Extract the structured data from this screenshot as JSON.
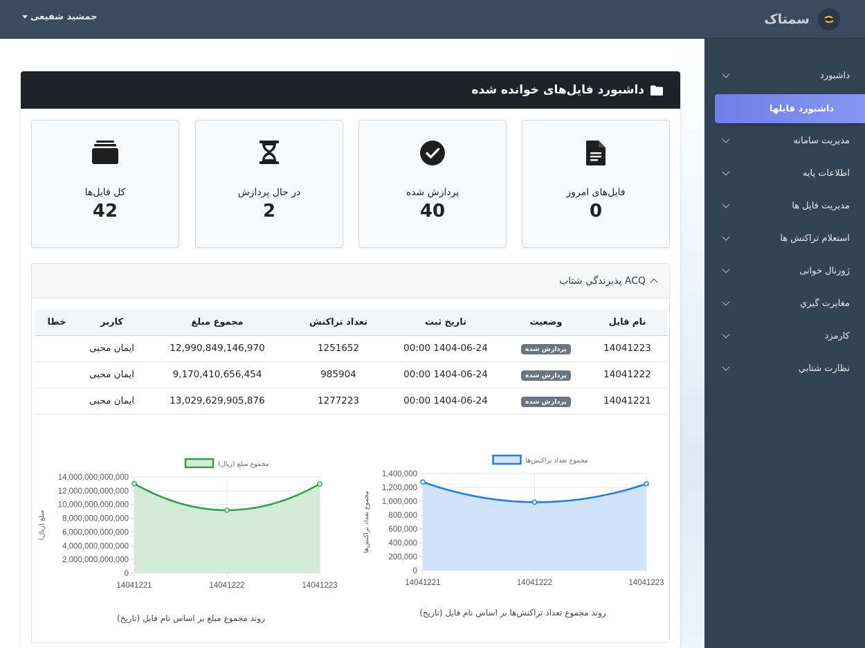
{
  "app": {
    "brand": "سمتاک",
    "user": "جمشید شفیعی"
  },
  "sidebar": {
    "items": [
      {
        "label": "داشبورد",
        "name": "dashboard"
      },
      {
        "label": "داشبورد فایلها",
        "name": "files-dashboard",
        "active": true
      },
      {
        "label": "مديريت سامانه",
        "name": "system-management"
      },
      {
        "label": "اطلاعات پايه",
        "name": "base-info"
      },
      {
        "label": "مدیریت فایل ها",
        "name": "file-management"
      },
      {
        "label": "استعلام تراکنش ها",
        "name": "transaction-inquiry"
      },
      {
        "label": "ژورنال خوانی",
        "name": "journal-reading"
      },
      {
        "label": "مغايرت گيري",
        "name": "reconciliation"
      },
      {
        "label": "کارمزد",
        "name": "commission"
      },
      {
        "label": "نظارت شتابي",
        "name": "shetab-monitoring"
      }
    ]
  },
  "page": {
    "title": "داشبورد فایل‌های خوانده شده"
  },
  "stats": [
    {
      "label": "فایل‌های امروز",
      "value": "0",
      "icon": "file-icon"
    },
    {
      "label": "پردازش شده",
      "value": "40",
      "icon": "check-circle-icon"
    },
    {
      "label": "در حال پردازش",
      "value": "2",
      "icon": "hourglass-icon"
    },
    {
      "label": "کل فایل‌ها",
      "value": "42",
      "icon": "layers-icon"
    }
  ],
  "acq": {
    "title": "پذيرندگي شتاب ACQ",
    "columns": [
      "نام فایل",
      "وضعیت",
      "تاریخ ثبت",
      "تعداد تراکنش",
      "مجموع مبلغ",
      "کاربر",
      "خطا"
    ],
    "rows": [
      {
        "file": "14041223",
        "status": "پردازش شده",
        "date": "1404-06-24 00:00",
        "count": "1251652",
        "amount": "12,990,849,146,970",
        "user": "ایمان محبی",
        "error": ""
      },
      {
        "file": "14041222",
        "status": "پردازش شده",
        "date": "1404-06-24 00:00",
        "count": "985904",
        "amount": "9,170,410,656,454",
        "user": "ایمان محبی",
        "error": ""
      },
      {
        "file": "14041221",
        "status": "پردازش شده",
        "date": "1404-06-24 00:00",
        "count": "1277223",
        "amount": "13,029,629,905,876",
        "user": "ایمان محبی",
        "error": ""
      }
    ]
  },
  "colors": {
    "green": "#2ea24a",
    "blue": "#1f7fe0",
    "header": "#1e2226",
    "sidebar": "#344256",
    "topbar": "#3b4a5e"
  },
  "chart_data": [
    {
      "type": "area",
      "title": "روند مجموع مبلغ بر اساس نام فایل (تاریخ)",
      "xlabel": "نام فایل (تاریخ)",
      "ylabel": "مبلغ (ریال)",
      "categories": [
        "14041221",
        "14041222",
        "14041223"
      ],
      "series": [
        {
          "name": "مجموع مبلغ (ریال)",
          "values": [
            13029629905876,
            9170410656454,
            12990849146970
          ]
        }
      ],
      "ylim": [
        0,
        14000000000000
      ],
      "yticks": [
        "0",
        "2,000,000,000,000",
        "4,000,000,000,000",
        "6,000,000,000,000",
        "8,000,000,000,000",
        "10,000,000,000,000",
        "12,000,000,000,000",
        "14,000,000,000,000"
      ],
      "color": "#2ea24a",
      "fill": "#d4ebd7",
      "legend": "top"
    },
    {
      "type": "area",
      "title": "روند مجموع تعداد تراکنش‌ها بر اساس نام فایل (تاریخ)",
      "xlabel": "نام فایل (تاریخ)",
      "ylabel": "مجموع تعداد تراکنش‌ها",
      "categories": [
        "14041221",
        "14041222",
        "14041223"
      ],
      "series": [
        {
          "name": "مجموع تعداد تراکنش‌ها",
          "values": [
            1277223,
            985904,
            1251652
          ]
        }
      ],
      "ylim": [
        0,
        1400000
      ],
      "yticks": [
        "0",
        "200,000",
        "400,000",
        "600,000",
        "800,000",
        "1,000,000",
        "1,200,000",
        "1,400,000"
      ],
      "color": "#1f7fe0",
      "fill": "#cfe4fa",
      "legend": "top"
    }
  ]
}
